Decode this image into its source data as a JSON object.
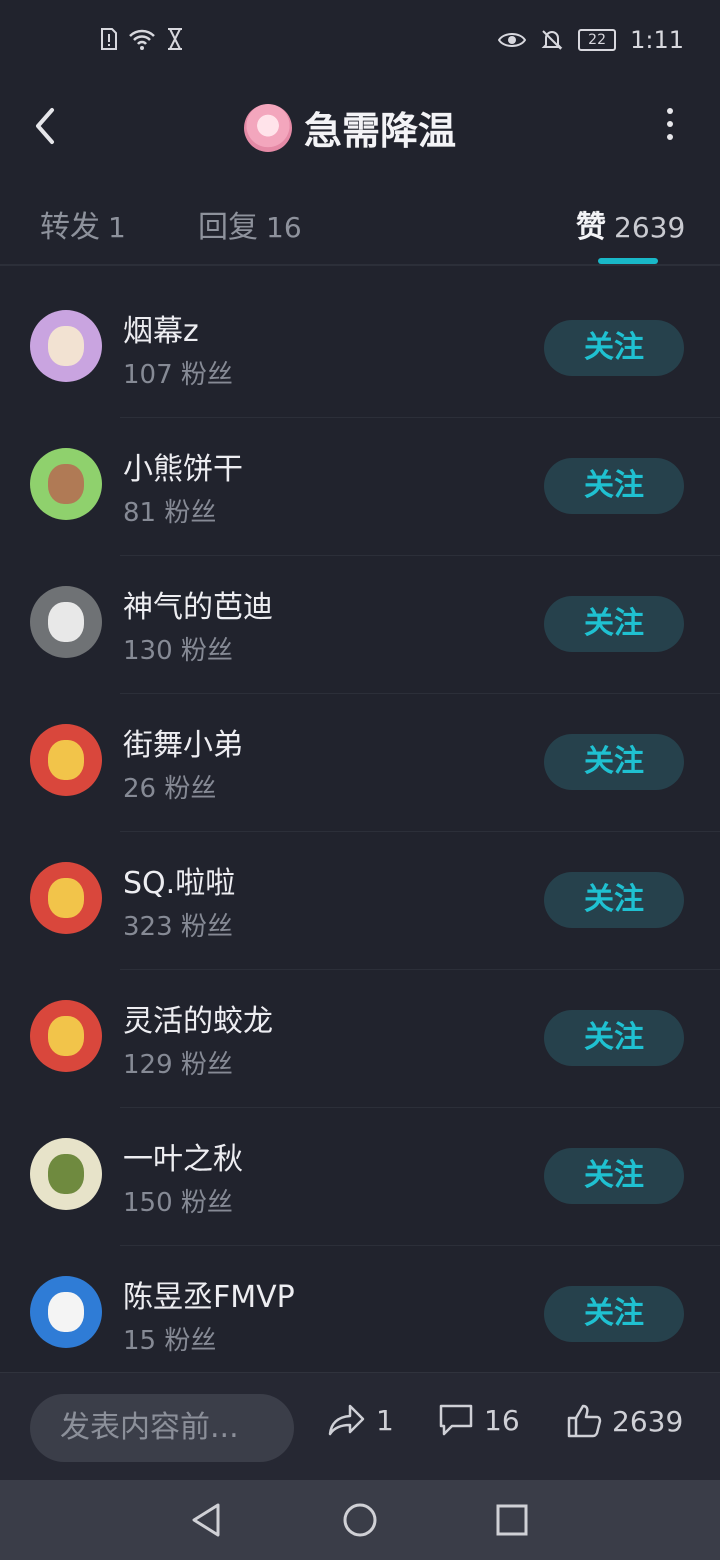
{
  "status_bar": {
    "time": "1:11",
    "battery": "22"
  },
  "header": {
    "title": "急需降温"
  },
  "tabs": [
    {
      "label": "转发",
      "count": "1"
    },
    {
      "label": "回复",
      "count": "16"
    },
    {
      "label": "赞",
      "count": "2639"
    }
  ],
  "users": [
    {
      "name": "烟幕z",
      "fans": "107 粉丝",
      "follow": "关注"
    },
    {
      "name": "小熊饼干",
      "fans": "81 粉丝",
      "follow": "关注"
    },
    {
      "name": "神气的芭迪",
      "fans": "130 粉丝",
      "follow": "关注"
    },
    {
      "name": "街舞小弟",
      "fans": "26 粉丝",
      "follow": "关注"
    },
    {
      "name": "SQ.啦啦",
      "fans": "323 粉丝",
      "follow": "关注"
    },
    {
      "name": "灵活的蛟龙",
      "fans": "129 粉丝",
      "follow": "关注"
    },
    {
      "name": "一叶之秋",
      "fans": "150 粉丝",
      "follow": "关注"
    },
    {
      "name": "陈昱丞FMVP",
      "fans": "15 粉丝",
      "follow": "关注"
    }
  ],
  "bottom": {
    "compose_placeholder": "发表内容前...",
    "repost_count": "1",
    "comment_count": "16",
    "like_count": "2639"
  },
  "colors": {
    "accent": "#19b8c8",
    "background": "#21232d"
  }
}
